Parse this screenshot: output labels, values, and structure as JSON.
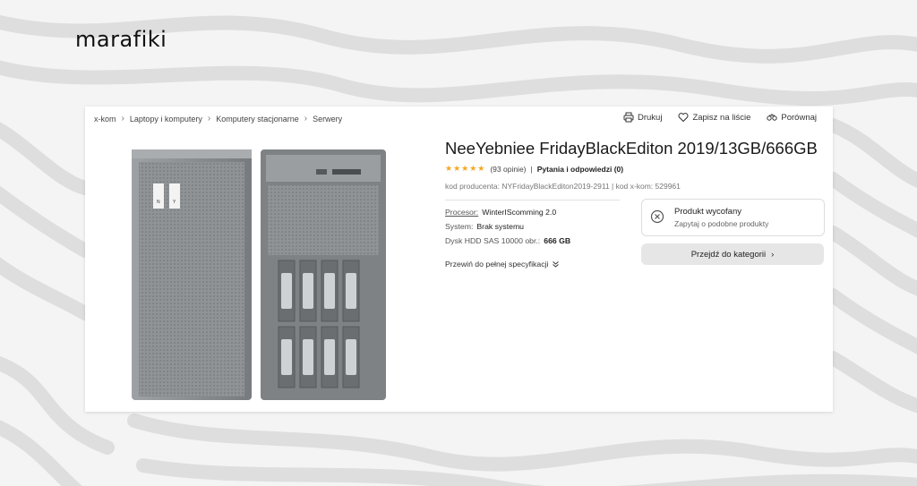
{
  "brand": {
    "logo": "marafiki"
  },
  "breadcrumb": [
    "x-kom",
    "Laptopy i komputery",
    "Komputery stacjonarne",
    "Serwery"
  ],
  "toolbar": {
    "print": "Drukuj",
    "save": "Zapisz na liście",
    "compare": "Porównaj"
  },
  "product": {
    "title": "NeeYebniee FridayBlackEditon 2019/13GB/666GB",
    "stars": "★★★★★",
    "rating": 4.5,
    "reviews": "(93 opinie)",
    "qa_sep": "|",
    "qa": "Pytania i odpowiedzi (0)",
    "codes": "kod producenta: NYFridayBlackEditon2019-2911  |  kod x-kom: 529961",
    "specs": [
      {
        "label": "Procesor:",
        "value": "WinterIScomming 2.0"
      },
      {
        "label": "System:",
        "value": "Brak systemu"
      },
      {
        "label": "Dysk HDD SAS 10000 obr.:",
        "value": "666 GB"
      }
    ],
    "full_spec_link": "Przewiń do pełnej specyfikacji",
    "image_label": {
      "left": "N",
      "right": "Y"
    }
  },
  "availability": {
    "title": "Produkt wycofany",
    "subtitle": "Zapytaj o podobne produkty",
    "button": "Przejdź do kategorii"
  },
  "colors": {
    "accent_star": "#f5a623",
    "button_bg": "#e6e6e6"
  }
}
